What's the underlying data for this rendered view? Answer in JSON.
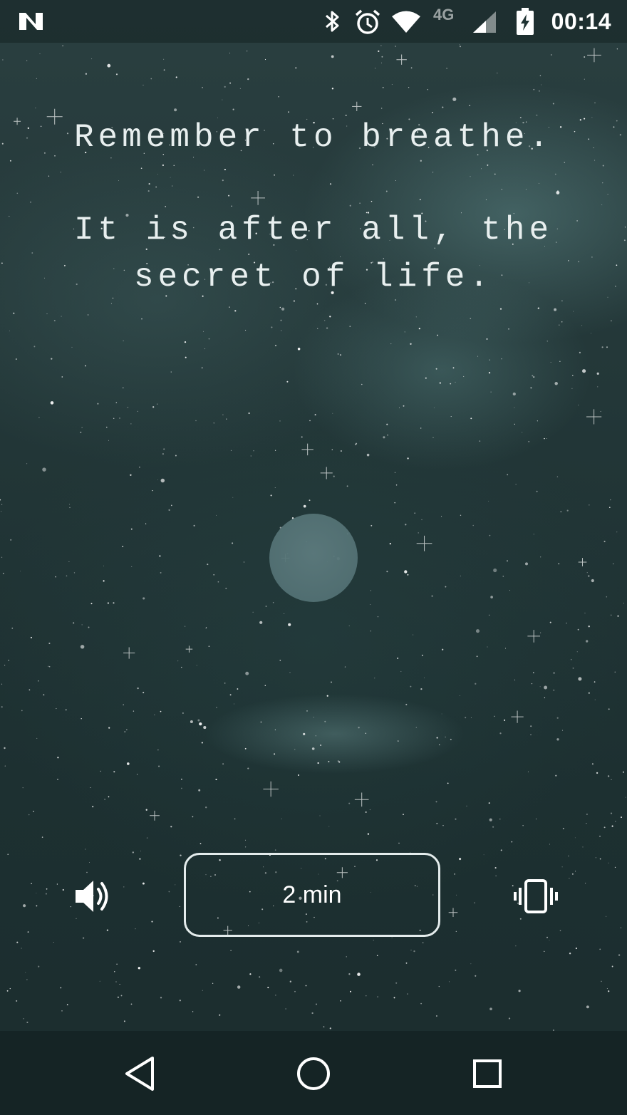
{
  "status_bar": {
    "time": "00:14",
    "network_type": "4G",
    "icons": [
      "notification-n-icon",
      "bluetooth-icon",
      "alarm-icon",
      "wifi-icon",
      "cell-signal-icon",
      "battery-charging-icon"
    ]
  },
  "quote": {
    "line1": "Remember to breathe.",
    "line2a": "It is after all, the",
    "line2b": "secret of life."
  },
  "controls": {
    "sound_icon": "volume-icon",
    "duration_label": "2 min",
    "vibrate_icon": "vibrate-icon"
  },
  "nav_bar": {
    "icons": [
      "back-icon",
      "home-icon",
      "recents-icon"
    ]
  },
  "colors": {
    "background": "#223637",
    "circle": "#55737a",
    "text": "#e8efef",
    "nav_bar": "#152425"
  }
}
